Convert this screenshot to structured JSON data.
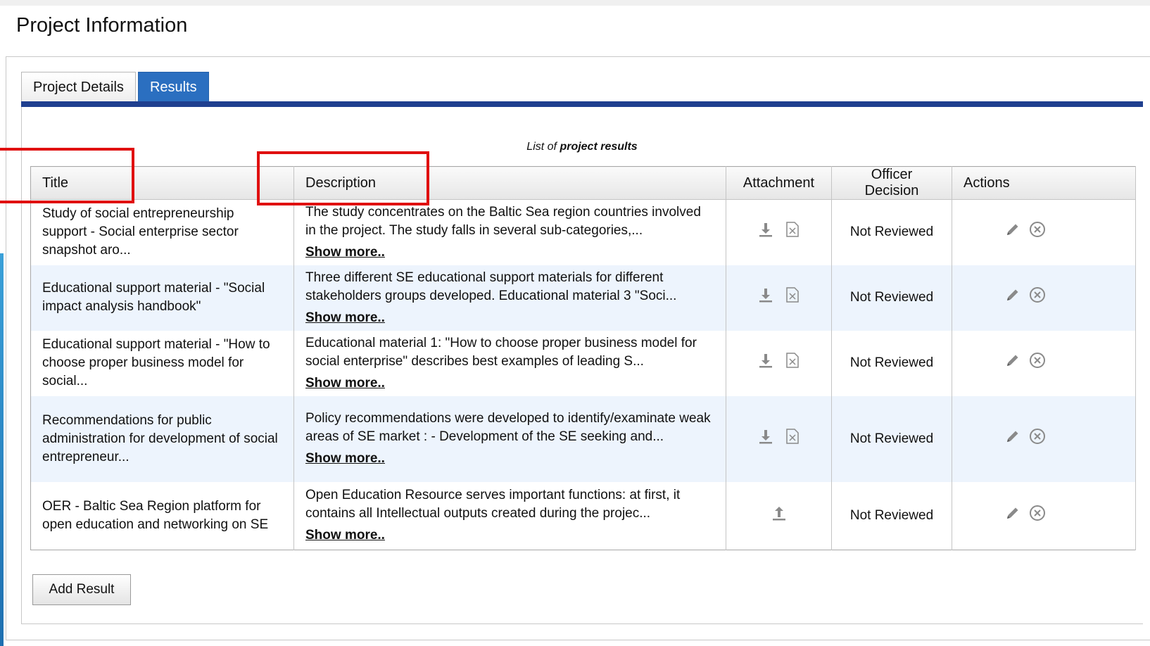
{
  "page": {
    "title": "Project Information"
  },
  "tabs": [
    {
      "label": "Project Details",
      "active": false
    },
    {
      "label": "Results",
      "active": true
    }
  ],
  "table": {
    "caption_prefix": "List of",
    "caption_emphasis": "project results",
    "columns": [
      "Title",
      "Description",
      "Attachment",
      "Officer Decision",
      "Actions"
    ],
    "rows": [
      {
        "title": "Study of social entrepreneurship support - Social enterprise sector snapshot aro...",
        "description": "The study concentrates on the Baltic Sea region countries involved in the project. The study falls in several sub-categories,...",
        "show_more": "Show more..",
        "attachment": [
          "download-icon",
          "delete-file-icon"
        ],
        "decision": "Not Reviewed"
      },
      {
        "title": "Educational support material - \"Social impact analysis handbook\"",
        "description": "Three different SE educational support materials for different stakeholders groups developed. Educational material 3 \"Soci...",
        "show_more": "Show more..",
        "attachment": [
          "download-icon",
          "delete-file-icon"
        ],
        "decision": "Not Reviewed"
      },
      {
        "title": "Educational support material - \"How to choose proper business model for social...",
        "description": "Educational material 1: \"How to choose proper business model for social enterprise\" describes best examples of leading S...",
        "show_more": "Show more..",
        "attachment": [
          "download-icon",
          "delete-file-icon"
        ],
        "decision": "Not Reviewed"
      },
      {
        "title": "Recommendations for public administration for development of social entrepreneur...",
        "description": "Policy recommendations were developed to identify/examinate weak areas of SE market : - Development of the SE seeking and...",
        "show_more": "Show more..",
        "attachment": [
          "download-icon",
          "delete-file-icon"
        ],
        "decision": "Not Reviewed"
      },
      {
        "title": "OER - Baltic Sea Region platform for open education and networking on SE",
        "description": "Open Education Resource serves important functions: at first, it contains all Intellectual outputs created during the projec...",
        "show_more": "Show more..",
        "attachment": [
          "upload-icon"
        ],
        "decision": "Not Reviewed"
      }
    ]
  },
  "add_button": {
    "label": "Add Result"
  },
  "colors": {
    "tab_active": "#2b6fc0",
    "tab_bar": "#1f3f8f",
    "row_alt": "#edf4fd",
    "highlight": "#e01010"
  }
}
